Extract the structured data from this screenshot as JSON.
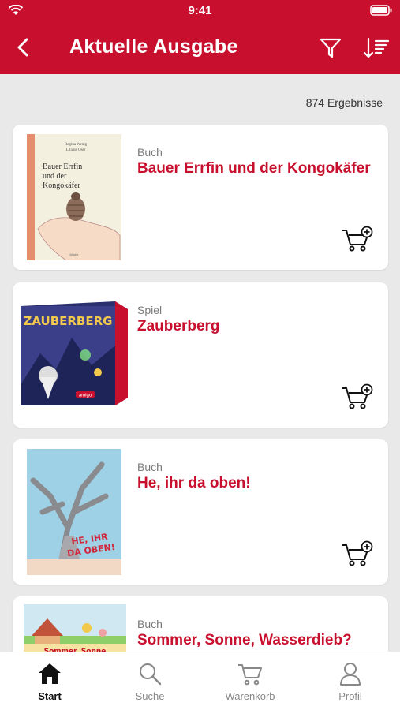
{
  "status_bar": {
    "time": "9:41"
  },
  "header": {
    "title": "Aktuelle Ausgabe"
  },
  "results_count": "874 Ergebnisse",
  "products": [
    {
      "category": "Buch",
      "title": "Bauer Errfin und der Kongokäfer",
      "cover_author": "Regina Wenig",
      "cover_illustrator": "Liliane Oser",
      "cover_title": "Bauer Errfin und der Kongokäfer",
      "cover_publisher": "Moritz"
    },
    {
      "category": "Spiel",
      "title": "Zauberberg",
      "cover_title": "ZAUBERBERG",
      "cover_brand": "amigo"
    },
    {
      "category": "Buch",
      "title": "He, ihr da oben!",
      "cover_title": "HE, IHR DA OBEN!"
    },
    {
      "category": "Buch",
      "title": "Sommer, Sonne, Wasserdieb?",
      "cover_title": "Sommer, Sonne"
    }
  ],
  "tabbar": {
    "items": [
      {
        "label": "Start",
        "icon": "home-icon",
        "active": true
      },
      {
        "label": "Suche",
        "icon": "search-icon",
        "active": false
      },
      {
        "label": "Warenkorb",
        "icon": "cart-icon",
        "active": false
      },
      {
        "label": "Profil",
        "icon": "profile-icon",
        "active": false
      }
    ]
  },
  "colors": {
    "brand": "#c8102e",
    "background": "#e9e9ea",
    "card": "#ffffff",
    "muted": "#7a7a7a"
  }
}
